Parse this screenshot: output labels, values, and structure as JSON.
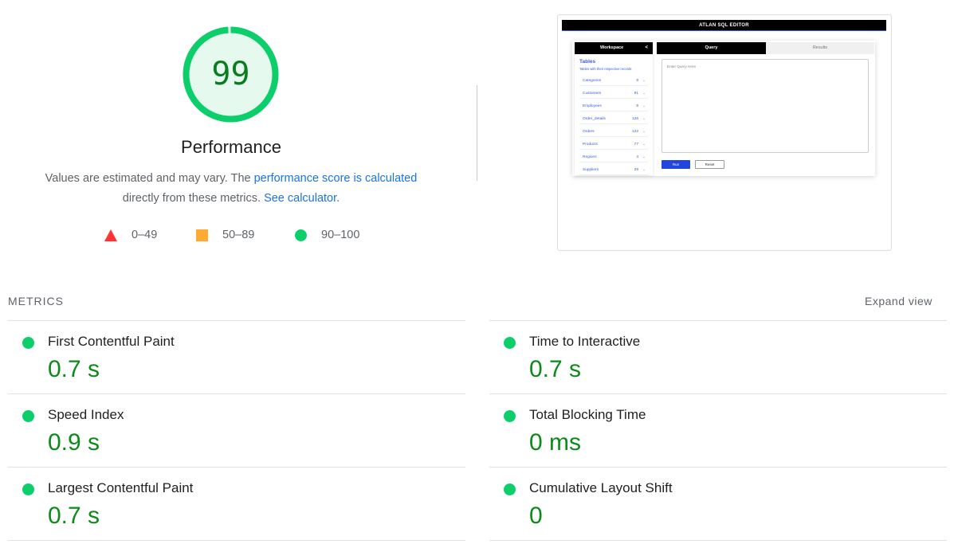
{
  "score": {
    "value": "99",
    "fraction": 0.99,
    "title": "Performance",
    "ring_color": "#0cce6b",
    "text_color": "#0c7d1f",
    "fill_color": "#e6f9ee"
  },
  "description": {
    "text_before": "Values are estimated and may vary. The ",
    "link1": "performance score is calculated",
    "text_middle": "directly from these metrics. ",
    "link2": "See calculator",
    "text_after": "."
  },
  "legend": [
    {
      "icon": "triangle-icon",
      "label": "0–49",
      "color": "#ff3333"
    },
    {
      "icon": "square-icon",
      "label": "50–89",
      "color": "#ffaa33"
    },
    {
      "icon": "circle-icon",
      "label": "90–100",
      "color": "#0cce6b"
    }
  ],
  "thumbnail": {
    "header": "ATLAN SQL EDITOR",
    "workspace": "Workspace",
    "collapse_arrow": "<",
    "tab_query": "Query",
    "tab_results": "Results",
    "tables_title": "Tables",
    "tables_subtitle": "Tables with their respective records",
    "tables": [
      {
        "name": "Categories",
        "count": "8",
        "arrow": "⌄"
      },
      {
        "name": "Customers",
        "count": "91",
        "arrow": "⌄"
      },
      {
        "name": "Employees",
        "count": "9",
        "arrow": "⌄"
      },
      {
        "name": "Order_details",
        "count": "126",
        "arrow": "⌄"
      },
      {
        "name": "Orders",
        "count": "122",
        "arrow": "⌄"
      },
      {
        "name": "Products",
        "count": "77",
        "arrow": "⌄"
      },
      {
        "name": "Regions",
        "count": "4",
        "arrow": "⌄"
      },
      {
        "name": "Suppliers",
        "count": "29",
        "arrow": "⌄"
      }
    ],
    "editor_placeholder": "Enter Query Here",
    "run_button": "Run",
    "reset_button": "Reset"
  },
  "metrics": {
    "title": "METRICS",
    "expand_label": "Expand view",
    "status_color": "#0cce6b",
    "items": [
      {
        "name": "First Contentful Paint",
        "value": "0.7 s"
      },
      {
        "name": "Time to Interactive",
        "value": "0.7 s"
      },
      {
        "name": "Speed Index",
        "value": "0.9 s"
      },
      {
        "name": "Total Blocking Time",
        "value": "0 ms"
      },
      {
        "name": "Largest Contentful Paint",
        "value": "0.7 s"
      },
      {
        "name": "Cumulative Layout Shift",
        "value": "0"
      }
    ]
  }
}
